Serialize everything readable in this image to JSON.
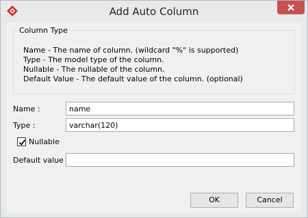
{
  "window": {
    "title": "Add Auto Column",
    "close_icon": "close-icon",
    "app_icon": "visual-paradigm-logo-icon"
  },
  "column_type_group": {
    "legend": "Column Type",
    "help_lines": [
      "Name - The name of column. (wildcard \"%\" is supported)",
      "Type - The model type of the column.",
      "Nullable - The nullable of the column.",
      "Default Value - The default value of the column. (optional)"
    ]
  },
  "form": {
    "name_label": "Name :",
    "name_value": "name",
    "type_label": "Type :",
    "type_value": "varchar(120)",
    "nullable_label": "Nullable",
    "nullable_checked": true,
    "default_label": "Default value :",
    "default_value": ""
  },
  "buttons": {
    "ok": "OK",
    "cancel": "Cancel"
  },
  "colors": {
    "close_button": "#c75050",
    "logo": "#d0342c"
  }
}
